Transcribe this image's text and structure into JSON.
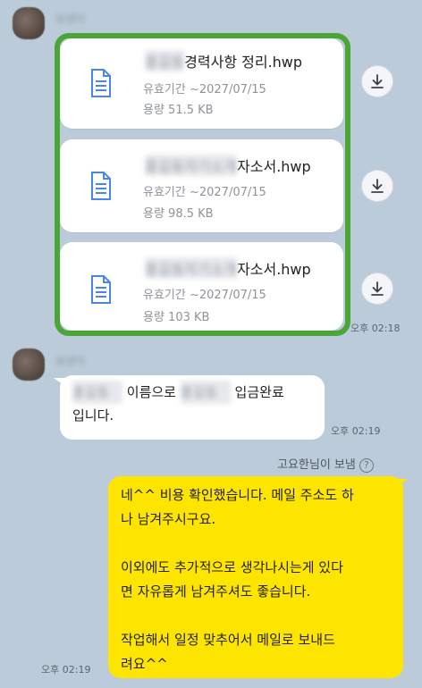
{
  "messages": {
    "file_group": {
      "files": [
        {
          "name_blurred": "홍길동",
          "name": "경력사항 정리.hwp",
          "validity": "유효기간 ~2027/07/15",
          "size": "용량 51.5 KB"
        },
        {
          "name_blurred": "홍길동자기소개",
          "name": "자소서.hwp",
          "validity": "유효기간 ~2027/07/15",
          "size": "용량 98.5 KB"
        },
        {
          "name_blurred": "홍길동자기소개",
          "name": "자소서.hwp",
          "validity": "유효기간 ~2027/07/15",
          "size": "용량 103 KB"
        }
      ],
      "time": "오후 02:18",
      "sender_blurred": "보낸이"
    },
    "deposit": {
      "sender_blurred": "보낸이",
      "name_blur_1": "홍길동",
      "text_1": "이름으로",
      "name_blur_2": "홍길동",
      "text_2": "입금완료",
      "line_2": "입니다.",
      "time": "오후 02:19"
    },
    "reply": {
      "sent_by": "고요한님이 보냄",
      "help": "?",
      "text": "네^^ 비용 확인했습니다. 메일 주소도 하\n나 남겨주시구요.\n\n이외에도 추가적으로 생각나시는게 있다\n면 자유롭게 남겨주셔도 좋습니다.\n\n작업해서 일정 맞추어서 메일로 보내드\n려요^^",
      "time": "오후 02:19"
    }
  },
  "colors": {
    "background": "#bccbd9",
    "highlight_frame": "#4aa637",
    "my_bubble": "#fee500",
    "file_icon": "#4a86e8"
  },
  "icons": {
    "file": "document-icon",
    "download": "download-icon"
  }
}
